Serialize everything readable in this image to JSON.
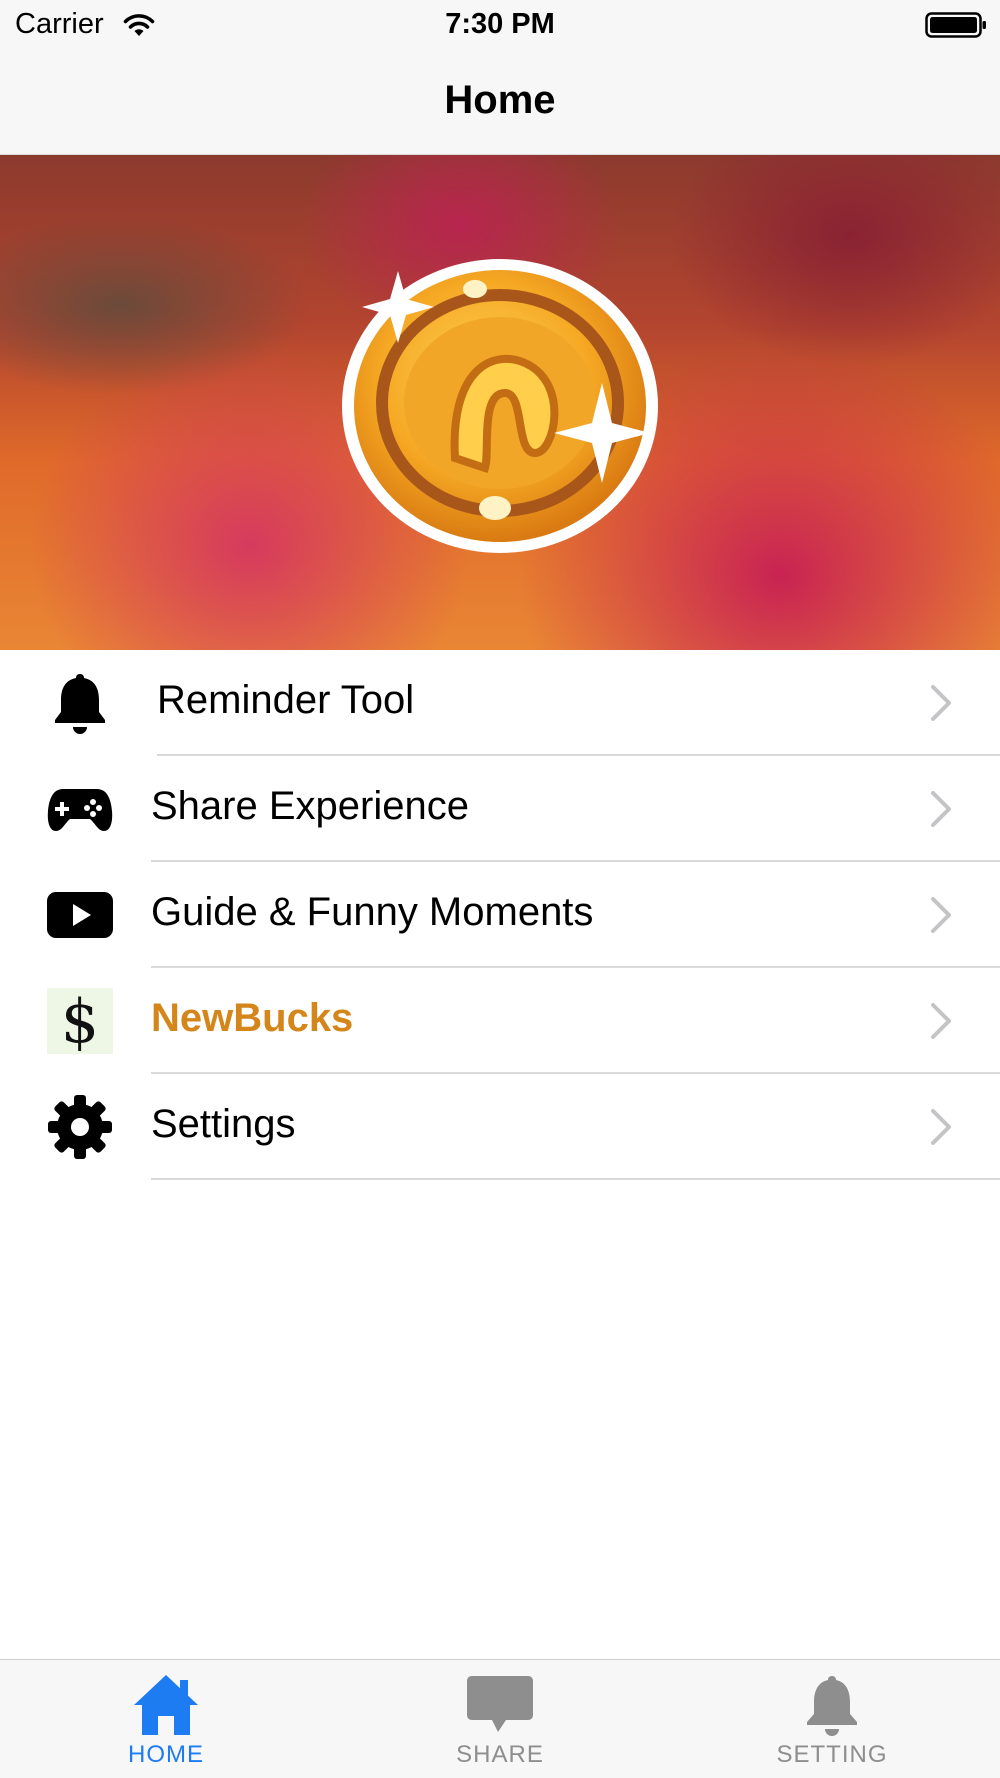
{
  "status_bar": {
    "carrier": "Carrier",
    "time": "7:30 PM"
  },
  "nav": {
    "title": "Home"
  },
  "menu": [
    {
      "label": "Reminder Tool",
      "icon": "bell-icon"
    },
    {
      "label": "Share Experience",
      "icon": "gamepad-icon"
    },
    {
      "label": "Guide & Funny Moments",
      "icon": "video-play-icon"
    },
    {
      "label": "NewBucks",
      "icon": "dollar-icon",
      "accent": "#d4861a"
    },
    {
      "label": "Settings",
      "icon": "gear-icon"
    }
  ],
  "tab_bar": {
    "active": "home",
    "active_color": "#1e7cf2",
    "inactive_color": "#8e8e8e",
    "tabs": [
      {
        "label": "HOME",
        "icon": "house-icon"
      },
      {
        "label": "SHARE",
        "icon": "speech-bubble-icon"
      },
      {
        "label": "SETTING",
        "icon": "bell-icon"
      }
    ]
  }
}
